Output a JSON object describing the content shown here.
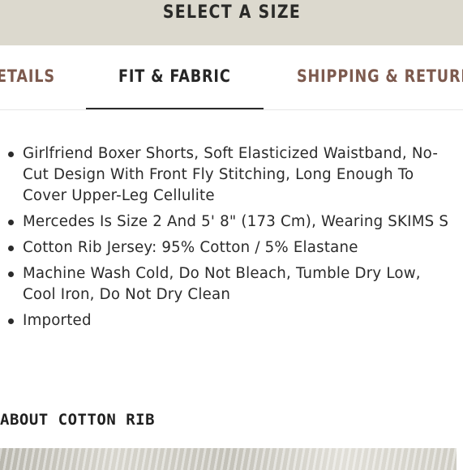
{
  "select_size": {
    "label": "SELECT A SIZE"
  },
  "tabs": [
    {
      "label": "DETAILS",
      "visible_text": "ETAILS",
      "active": false
    },
    {
      "label": "FIT & FABRIC",
      "visible_text": "FIT & FABRIC",
      "active": true
    },
    {
      "label": "SHIPPING & RETURNS",
      "visible_text": "SHIPPING & RETURN",
      "active": false
    }
  ],
  "details": [
    "Girlfriend Boxer Shorts, Soft Elasticized Waistband, No-Cut Design With Front Fly Stitching, Long Enough To Cover Upper-Leg Cellulite",
    "Mercedes Is Size 2 And 5' 8\" (173 Cm), Wearing SKIMS S",
    "Cotton Rib Jersey: 95% Cotton / 5% Elastane",
    "Machine Wash Cold, Do Not Bleach, Tumble Dry Low, Cool Iron, Do Not Dry Clean",
    "Imported"
  ],
  "about": {
    "heading": "ABOUT COTTON RIB"
  },
  "colors": {
    "size_bar_bg": "#dcd9ce",
    "inactive_tab": "#7d5a4e",
    "active_tab": "#262626",
    "text": "#2b2b2b"
  }
}
